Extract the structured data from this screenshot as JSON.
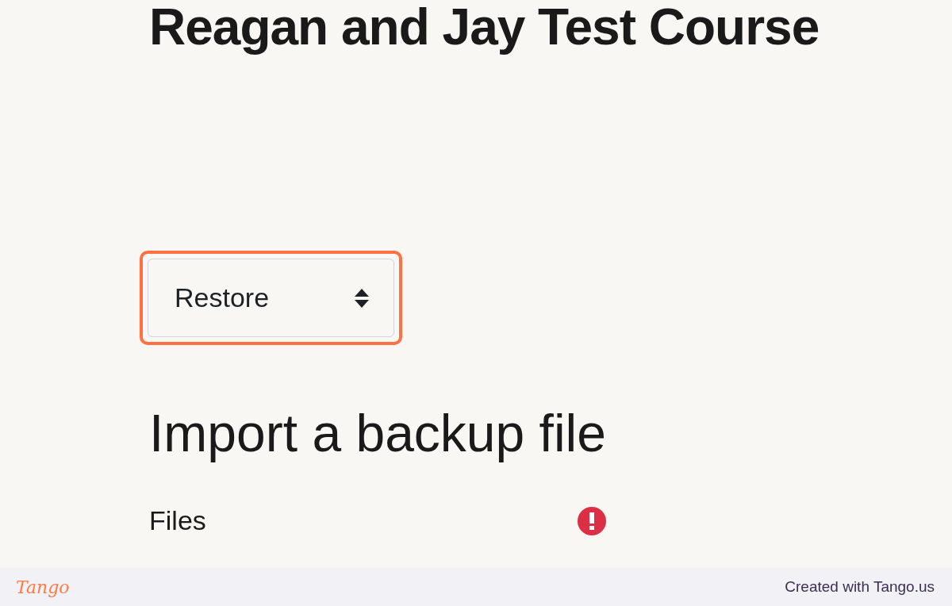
{
  "course_title": "Reagan and Jay Test Course",
  "action_select": {
    "value": "Restore",
    "highlighted": true
  },
  "section_heading": "Import a backup file",
  "files_field": {
    "label": "Files",
    "required": true
  },
  "footer": {
    "logo": "Tango",
    "credit": "Created with Tango.us"
  }
}
